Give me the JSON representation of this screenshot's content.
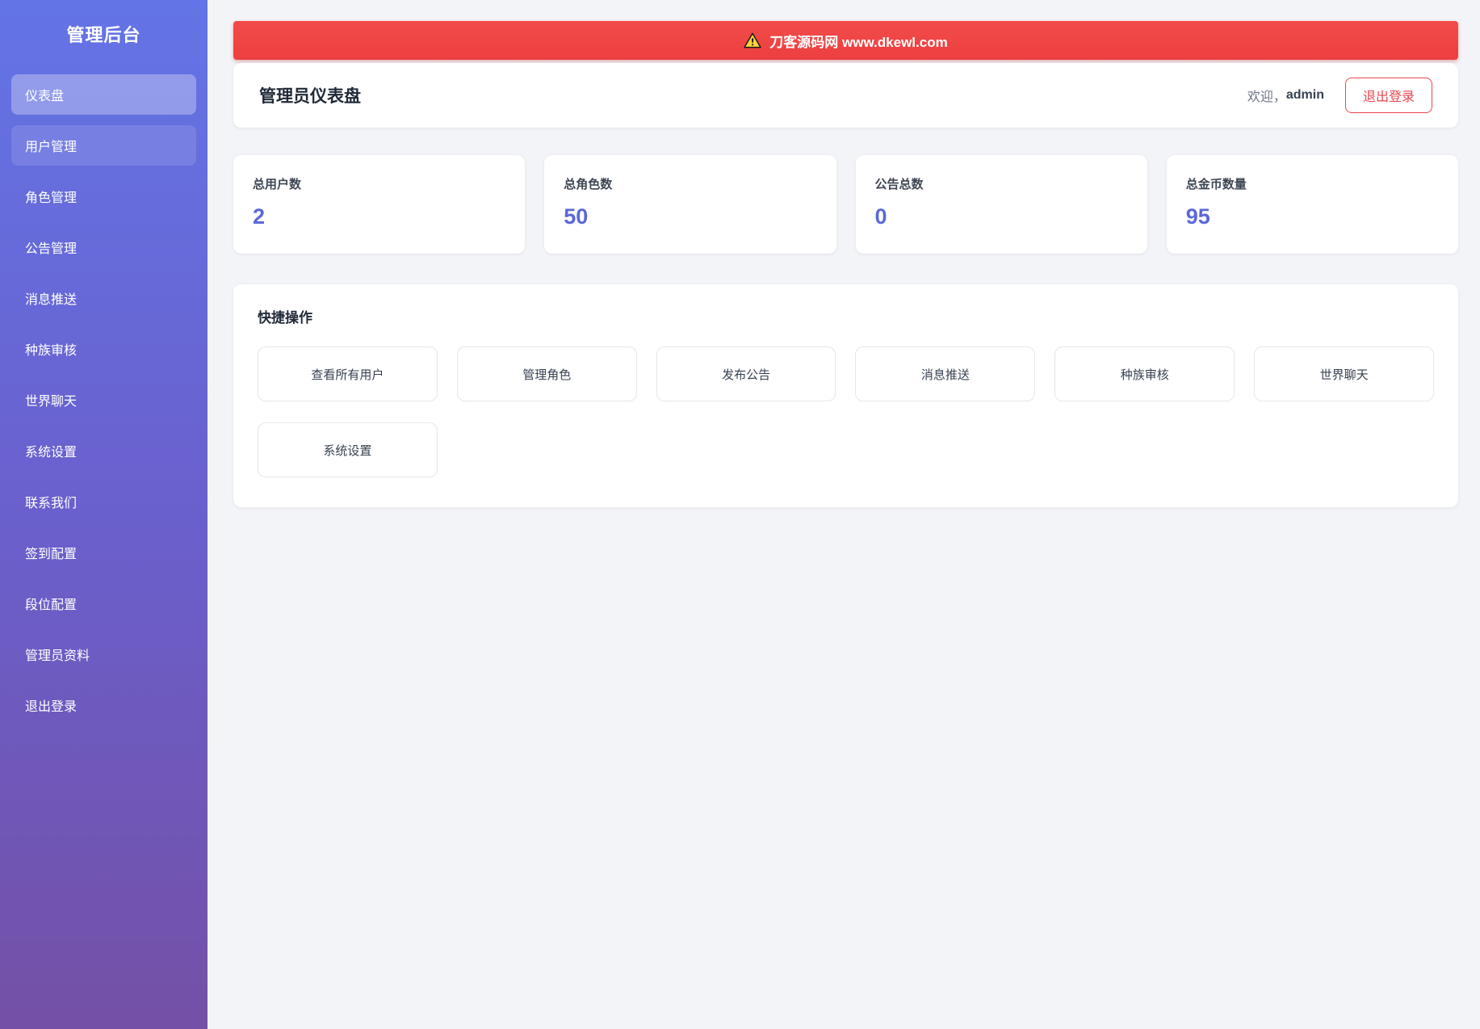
{
  "sidebar": {
    "title": "管理后台",
    "items": [
      {
        "label": "仪表盘",
        "state": "active"
      },
      {
        "label": "用户管理",
        "state": "hover"
      },
      {
        "label": "角色管理"
      },
      {
        "label": "公告管理"
      },
      {
        "label": "消息推送"
      },
      {
        "label": "种族审核"
      },
      {
        "label": "世界聊天"
      },
      {
        "label": "系统设置"
      },
      {
        "label": "联系我们"
      },
      {
        "label": "签到配置"
      },
      {
        "label": "段位配置"
      },
      {
        "label": "管理员资料"
      },
      {
        "label": "退出登录"
      }
    ]
  },
  "banner": {
    "icon": "warning-icon",
    "text": "刀客源码网 www.dkewl.com"
  },
  "header": {
    "title": "管理员仪表盘",
    "welcome_prefix": "欢迎，",
    "username": "admin",
    "logout_label": "退出登录"
  },
  "stats": [
    {
      "label": "总用户数",
      "value": "2"
    },
    {
      "label": "总角色数",
      "value": "50"
    },
    {
      "label": "公告总数",
      "value": "0"
    },
    {
      "label": "总金币数量",
      "value": "95"
    }
  ],
  "quick_actions": {
    "title": "快捷操作",
    "buttons": [
      "查看所有用户",
      "管理角色",
      "发布公告",
      "消息推送",
      "种族审核",
      "世界聊天",
      "系统设置"
    ]
  },
  "colors": {
    "sidebar_gradient_top": "#6374e6",
    "sidebar_gradient_bottom": "#7450a6",
    "banner_red": "#ee4040",
    "warning_yellow": "#ffd43b",
    "stat_value_indigo": "#5a68d9",
    "logout_red": "#e8474f",
    "page_background": "#f3f4f8"
  }
}
